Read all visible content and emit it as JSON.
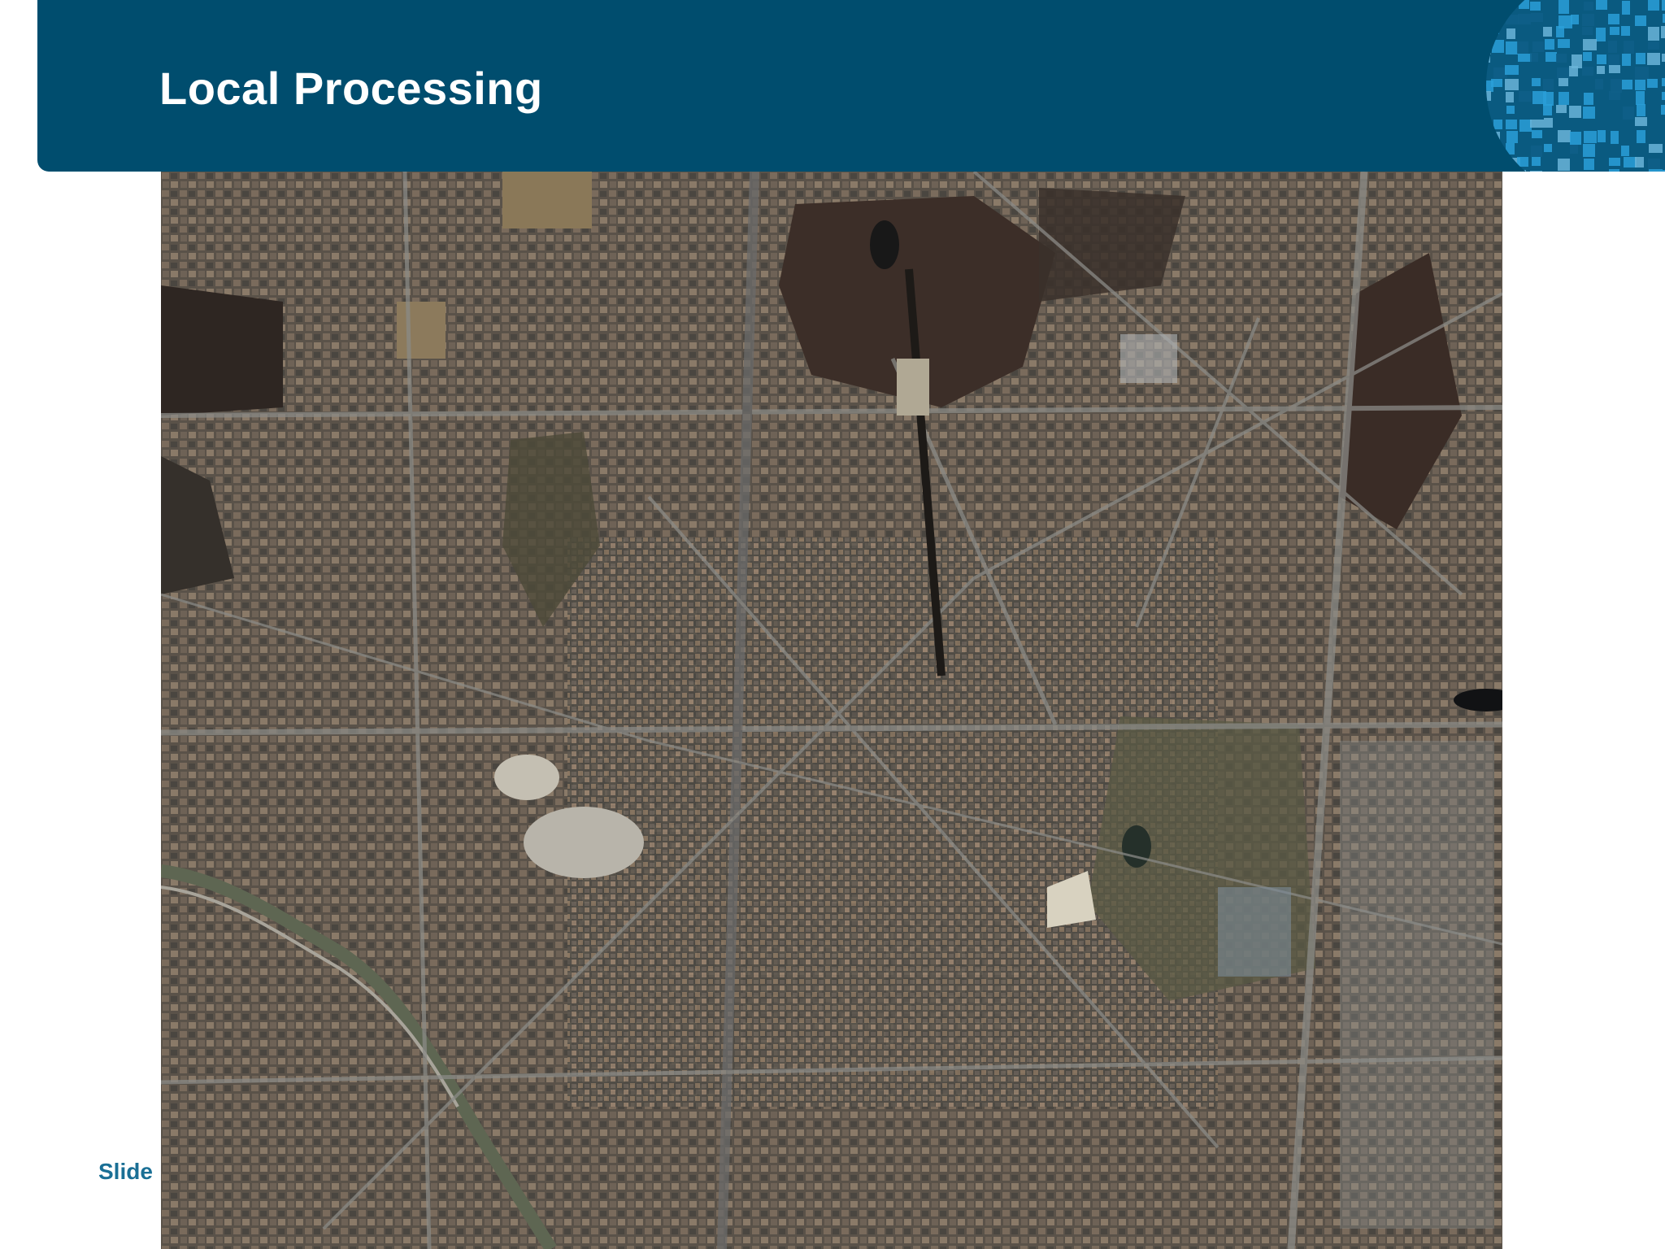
{
  "slide": {
    "title": "Local Processing",
    "footer_label": "Slide",
    "image_description_name": "aerial-city-image"
  },
  "colors": {
    "header_bg": "#004d6e",
    "title_text": "#ffffff",
    "footer_text": "#1a6f95",
    "globe_light": "#2a9fd8",
    "globe_dark": "#0f5f88"
  },
  "icons": {
    "decorative_globe": "pixel-globe-icon"
  }
}
